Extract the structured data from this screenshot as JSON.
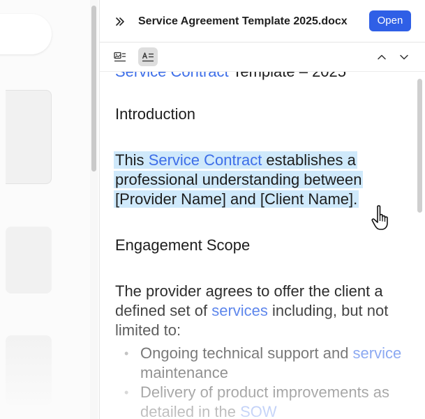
{
  "header": {
    "title": "Service Agreement Template 2025.docx",
    "open_label": "Open"
  },
  "toolbar": {
    "image_view_icon": "image-view-icon",
    "text_view_icon": "text-view-icon",
    "up_icon": "chevron-up-icon",
    "down_icon": "chevron-down-icon"
  },
  "document": {
    "title_link": "Service Contract",
    "title_rest": " Template – 2025",
    "intro_heading": "Introduction",
    "intro_p_start": "This ",
    "intro_p_link": "Service Contract",
    "intro_p_rest": " establishes a professional understanding between [Provider Name] and [Client Name].",
    "scope_heading": "Engagement Scope",
    "scope_p_start": "The provider agrees to offer the client a defined set of ",
    "scope_p_link": "services",
    "scope_p_rest": " including, but not limited to:",
    "bullet1_start": "Ongoing technical support and ",
    "bullet1_link": "service",
    "bullet1_rest": " maintenance",
    "bullet2_start": "Delivery of product improvements as detailed in the ",
    "bullet2_link": "SOW"
  },
  "colors": {
    "accent": "#2f5fe6",
    "link": "#3d6ee8",
    "highlight": "#cfe9fb"
  }
}
